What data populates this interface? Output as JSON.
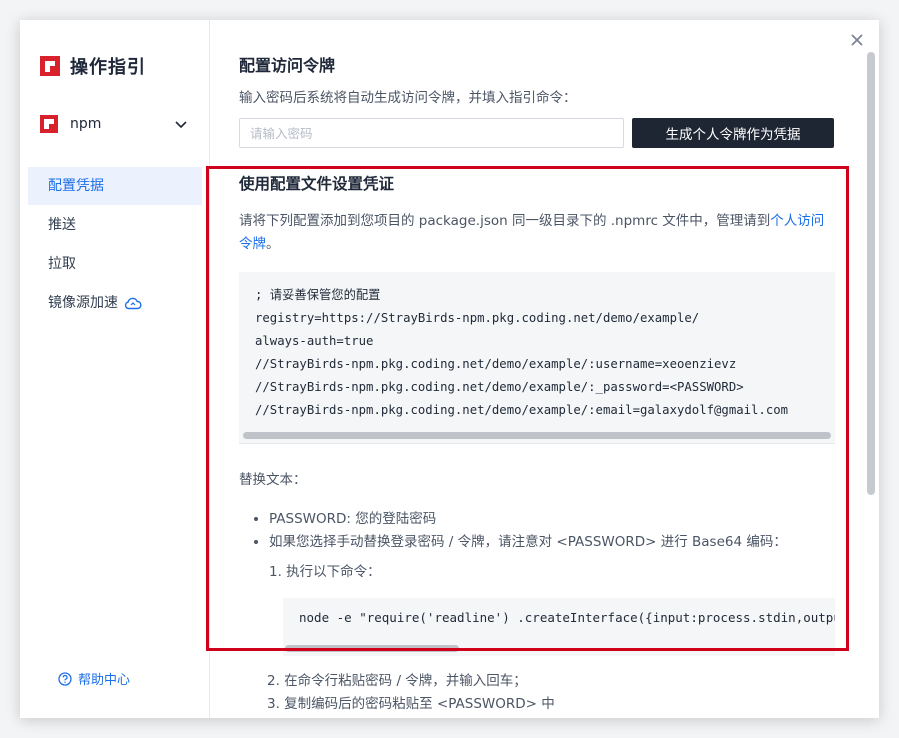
{
  "sidebar": {
    "title": "操作指引",
    "package": "npm",
    "items": [
      {
        "label": "配置凭据",
        "active": true
      },
      {
        "label": "推送",
        "active": false
      },
      {
        "label": "拉取",
        "active": false
      },
      {
        "label": "镜像源加速",
        "active": false,
        "icon": "cloud-icon"
      }
    ],
    "help": "帮助中心"
  },
  "main": {
    "token_title": "配置访问令牌",
    "token_desc": "输入密码后系统将自动生成访问令牌，并填入指引命令：",
    "password_placeholder": "请输入密码",
    "generate_button": "生成个人令牌作为凭据",
    "config_title": "使用配置文件设置凭证",
    "config_desc": "请将下列配置添加到您项目的 package.json 同一级目录下的 .npmrc 文件中，管理请到",
    "config_link": "个人访问令牌",
    "config_desc_end": "。",
    "code_lines": [
      "; 请妥善保管您的配置",
      "registry=https://StrayBirds-npm.pkg.coding.net/demo/example/",
      "always-auth=true",
      "//StrayBirds-npm.pkg.coding.net/demo/example/:username=xeoenzievz",
      "//StrayBirds-npm.pkg.coding.net/demo/example/:_password=<PASSWORD>",
      "//StrayBirds-npm.pkg.coding.net/demo/example/:email=galaxydolf@gmail.com"
    ],
    "replace_title": "替换文本：",
    "bullets": [
      "PASSWORD: 您的登陆密码",
      "如果您选择手动替换登录密码 / 令牌，请注意对 <PASSWORD> 进行 Base64 编码："
    ],
    "step1": "1. 执行以下命令：",
    "command": "node -e \"require('readline') .createInterface({input:process.stdin,output:process.stdout})",
    "step2": "2. 在命令行粘贴密码 / 令牌，并输入回车；",
    "step3": "3. 复制编码后的密码粘贴至 <PASSWORD> 中"
  },
  "colors": {
    "accent": "#1d6fe8",
    "brand": "#d9212c",
    "highlight": "#d0021b",
    "button_bg": "#1e2634"
  }
}
